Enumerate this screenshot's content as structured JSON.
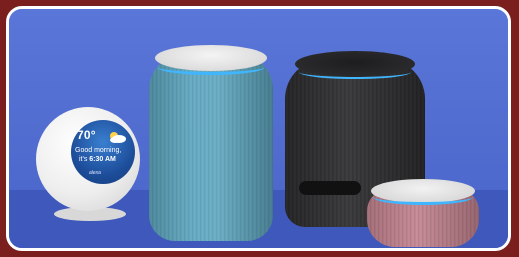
{
  "image": {
    "frame_color": "#7a1e1e",
    "background_color": "#4f6bd0",
    "accent_light_color": "#3fb6ff"
  },
  "devices": [
    {
      "name": "echo-spot",
      "color": "white"
    },
    {
      "name": "echo-plus",
      "color": "#5ea5bd"
    },
    {
      "name": "echo-studio",
      "color": "#333333"
    },
    {
      "name": "echo-dot",
      "color": "#be8290"
    }
  ],
  "spot_screen": {
    "temperature": "70°",
    "greeting": "Good morning,",
    "time_prefix": "it's ",
    "time": "6:30 AM",
    "brand": "alexa",
    "weather_icon": "partly-cloudy-icon"
  }
}
